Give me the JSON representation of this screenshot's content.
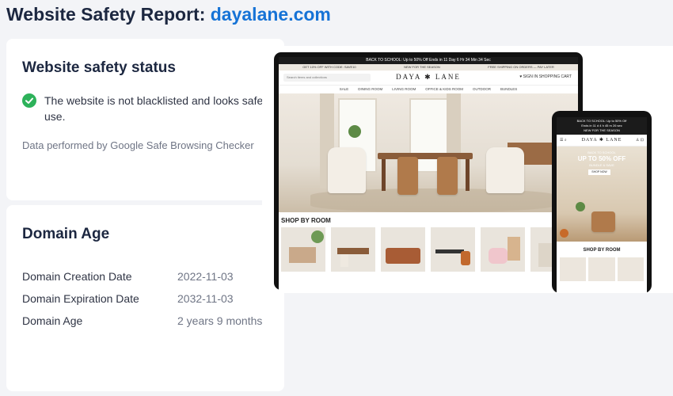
{
  "header": {
    "title_prefix": "Website Safety Report:",
    "domain": "dayalane.com"
  },
  "safety": {
    "title": "Website safety status",
    "status_text": "The website is not blacklisted and looks safe to use.",
    "source": "Data performed by Google Safe Browsing Checker",
    "status_color": "#2db25a"
  },
  "domain_age": {
    "title": "Domain Age",
    "rows": [
      {
        "label": "Domain Creation Date",
        "value": "2022-11-03"
      },
      {
        "label": "Domain Expiration Date",
        "value": "2032-11-03"
      },
      {
        "label": "Domain Age",
        "value": "2 years 9 months"
      }
    ]
  },
  "preview": {
    "promo": "BACK TO SCHOOL: Up to 50% Off Ends in 11 Day 6 Hr 34 Min 34 Sec",
    "ship_left": "GET 10% OFF WITH CODE: SAVE10",
    "ship_mid": "NEW FOR THE SEASON",
    "ship_right": "FREE SHIPPING ON ORDERS — PAY LATER",
    "search_placeholder": "Search items and collections",
    "brand": "DAYA ✱ LANE",
    "nav_icons": "♥  SIGN IN   SHOPPING CART",
    "menu": [
      "SALE",
      "DINING ROOM",
      "LIVING ROOM",
      "OFFICE & KIDS ROOM",
      "OUTDOOR",
      "BUNDLES"
    ],
    "shop_title": "SHOP BY ROOM",
    "phone_promo_1": "BACK TO SCHOOL: Up to 50% Off",
    "phone_promo_2": "Ends in 11 d 4 h 45 m 26 sec",
    "phone_promo_3": "NEW FOR THE SEASON",
    "phone_brand": "DAYA ✱ LANE",
    "phone_hero_small": "BACK TO SCHOOL",
    "phone_hero_big": "UP TO 50% OFF",
    "phone_hero_sub": "BUNDLE & SAVE",
    "phone_hero_btn": "SHOP NOW",
    "phone_shop_title": "SHOP BY ROOM"
  }
}
